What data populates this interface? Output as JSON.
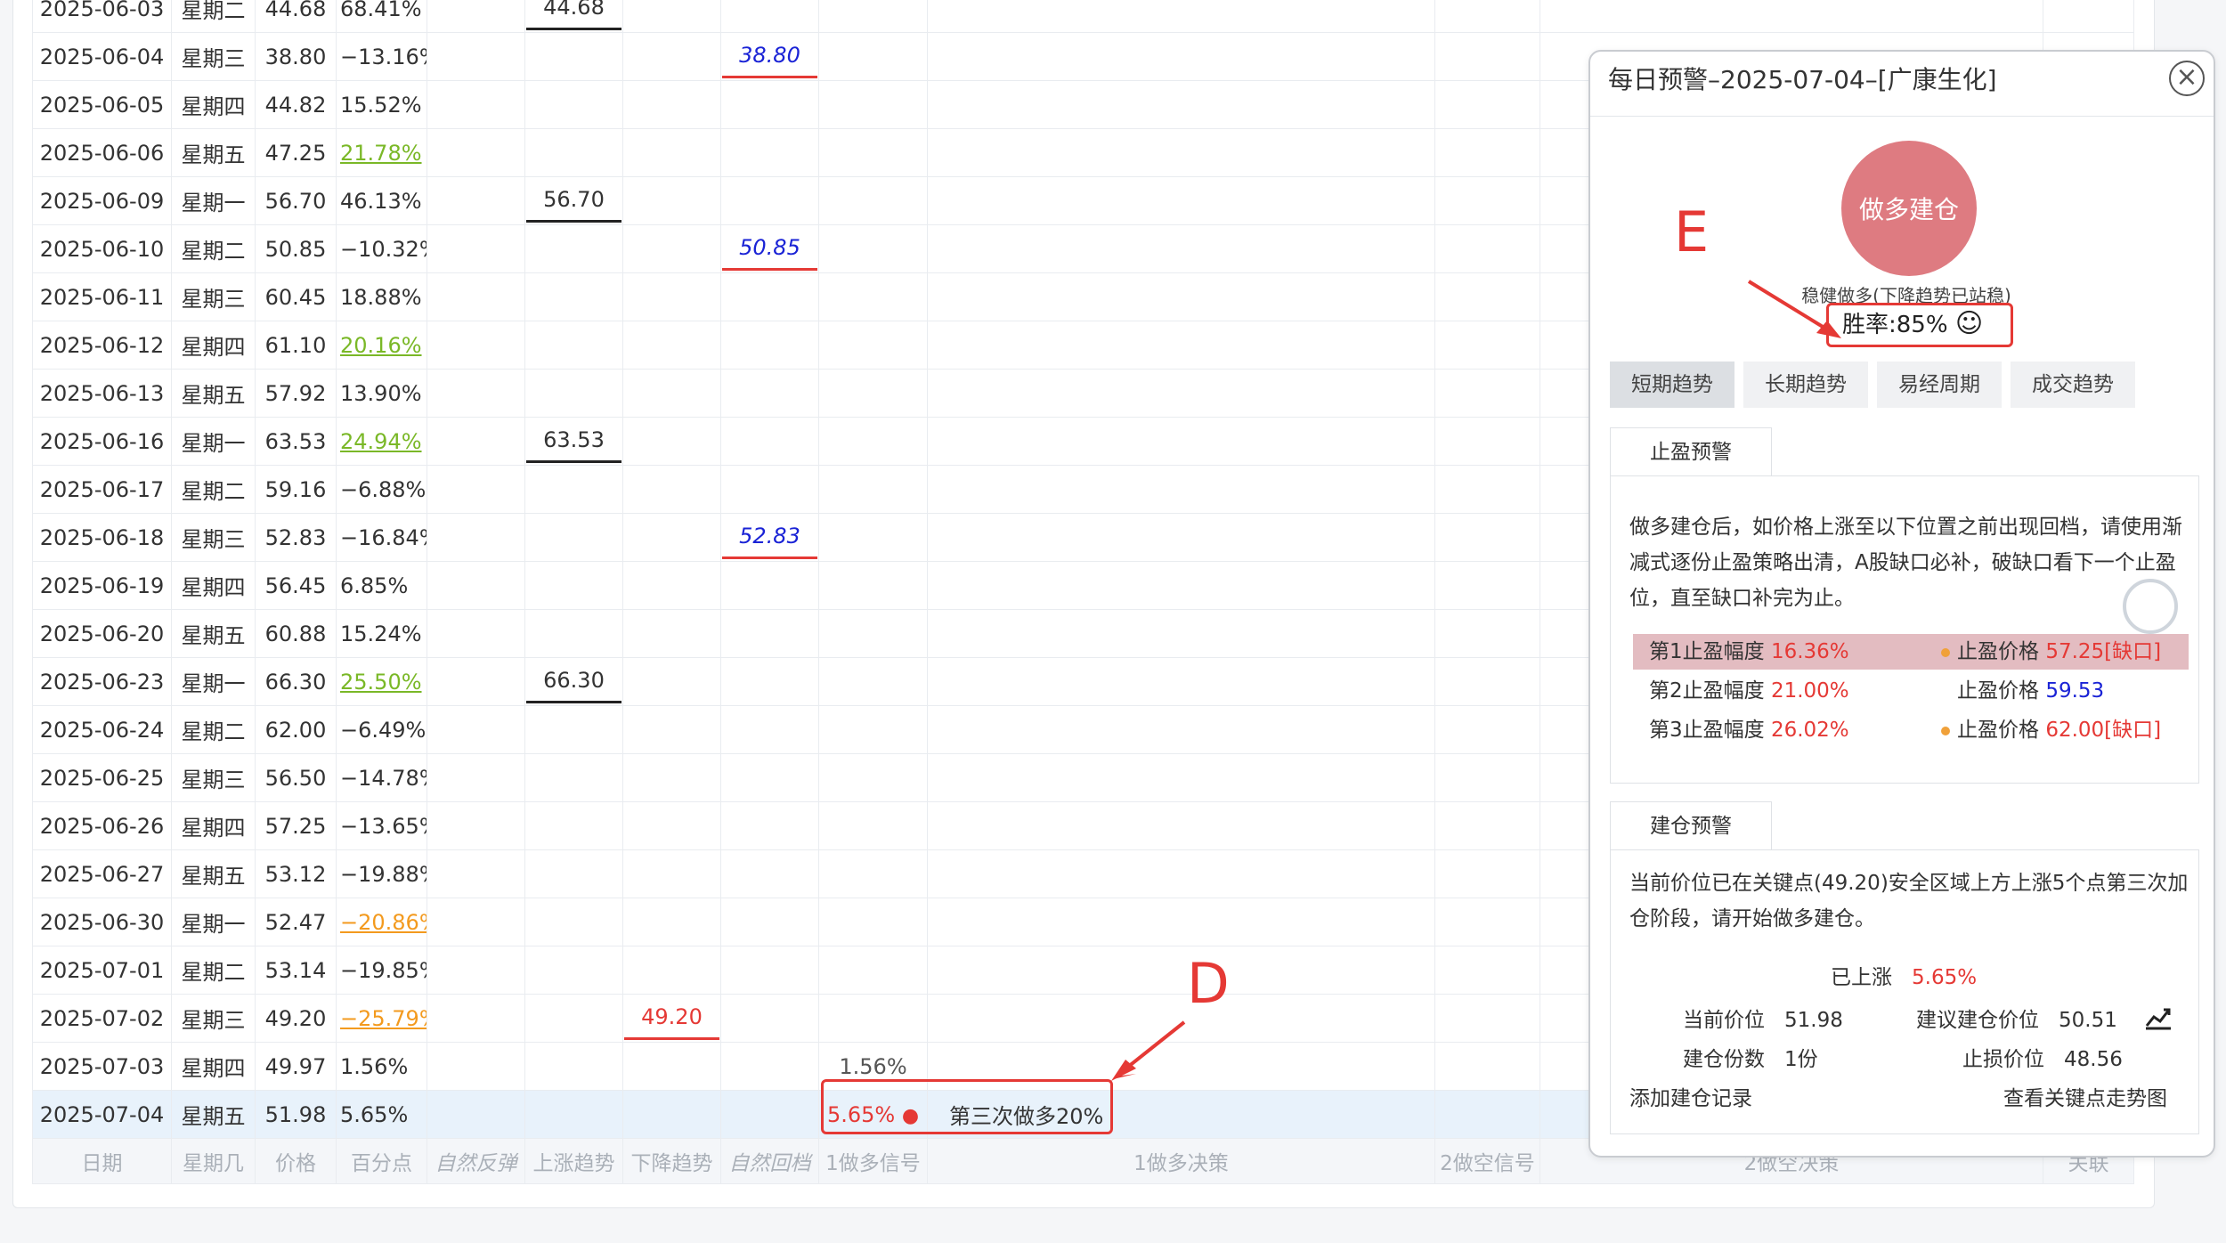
{
  "table": {
    "rows": [
      {
        "date": "2025-06-03",
        "week": "星期二",
        "price": "44.68",
        "pct": "68.41%",
        "pct_style": "",
        "up": "44.68",
        "down": "",
        "rebound": "",
        "pullback": "",
        "sig": ""
      },
      {
        "date": "2025-06-04",
        "week": "星期三",
        "price": "38.80",
        "pct": "−13.16%",
        "pct_style": "",
        "up": "",
        "down": "",
        "rebound": "",
        "pullback": "38.80",
        "sig": ""
      },
      {
        "date": "2025-06-05",
        "week": "星期四",
        "price": "44.82",
        "pct": "15.52%",
        "pct_style": "",
        "up": "",
        "down": "",
        "rebound": "",
        "pullback": "",
        "sig": ""
      },
      {
        "date": "2025-06-06",
        "week": "星期五",
        "price": "47.25",
        "pct": "21.78%",
        "pct_style": "green",
        "up": "",
        "down": "",
        "rebound": "",
        "pullback": "",
        "sig": ""
      },
      {
        "date": "2025-06-09",
        "week": "星期一",
        "price": "56.70",
        "pct": "46.13%",
        "pct_style": "",
        "up": "56.70",
        "down": "",
        "rebound": "",
        "pullback": "",
        "sig": ""
      },
      {
        "date": "2025-06-10",
        "week": "星期二",
        "price": "50.85",
        "pct": "−10.32%",
        "pct_style": "",
        "up": "",
        "down": "",
        "rebound": "",
        "pullback": "50.85",
        "sig": ""
      },
      {
        "date": "2025-06-11",
        "week": "星期三",
        "price": "60.45",
        "pct": "18.88%",
        "pct_style": "",
        "up": "",
        "down": "",
        "rebound": "",
        "pullback": "",
        "sig": ""
      },
      {
        "date": "2025-06-12",
        "week": "星期四",
        "price": "61.10",
        "pct": "20.16%",
        "pct_style": "green",
        "up": "",
        "down": "",
        "rebound": "",
        "pullback": "",
        "sig": ""
      },
      {
        "date": "2025-06-13",
        "week": "星期五",
        "price": "57.92",
        "pct": "13.90%",
        "pct_style": "",
        "up": "",
        "down": "",
        "rebound": "",
        "pullback": "",
        "sig": ""
      },
      {
        "date": "2025-06-16",
        "week": "星期一",
        "price": "63.53",
        "pct": "24.94%",
        "pct_style": "green",
        "up": "63.53",
        "down": "",
        "rebound": "",
        "pullback": "",
        "sig": ""
      },
      {
        "date": "2025-06-17",
        "week": "星期二",
        "price": "59.16",
        "pct": "−6.88%",
        "pct_style": "",
        "up": "",
        "down": "",
        "rebound": "",
        "pullback": "",
        "sig": ""
      },
      {
        "date": "2025-06-18",
        "week": "星期三",
        "price": "52.83",
        "pct": "−16.84%",
        "pct_style": "",
        "up": "",
        "down": "",
        "rebound": "",
        "pullback": "52.83",
        "sig": ""
      },
      {
        "date": "2025-06-19",
        "week": "星期四",
        "price": "56.45",
        "pct": "6.85%",
        "pct_style": "",
        "up": "",
        "down": "",
        "rebound": "",
        "pullback": "",
        "sig": ""
      },
      {
        "date": "2025-06-20",
        "week": "星期五",
        "price": "60.88",
        "pct": "15.24%",
        "pct_style": "",
        "up": "",
        "down": "",
        "rebound": "",
        "pullback": "",
        "sig": ""
      },
      {
        "date": "2025-06-23",
        "week": "星期一",
        "price": "66.30",
        "pct": "25.50%",
        "pct_style": "green",
        "up": "66.30",
        "down": "",
        "rebound": "",
        "pullback": "",
        "sig": ""
      },
      {
        "date": "2025-06-24",
        "week": "星期二",
        "price": "62.00",
        "pct": "−6.49%",
        "pct_style": "",
        "up": "",
        "down": "",
        "rebound": "",
        "pullback": "",
        "sig": ""
      },
      {
        "date": "2025-06-25",
        "week": "星期三",
        "price": "56.50",
        "pct": "−14.78%",
        "pct_style": "",
        "up": "",
        "down": "",
        "rebound": "",
        "pullback": "",
        "sig": ""
      },
      {
        "date": "2025-06-26",
        "week": "星期四",
        "price": "57.25",
        "pct": "−13.65%",
        "pct_style": "",
        "up": "",
        "down": "",
        "rebound": "",
        "pullback": "",
        "sig": ""
      },
      {
        "date": "2025-06-27",
        "week": "星期五",
        "price": "53.12",
        "pct": "−19.88%",
        "pct_style": "",
        "up": "",
        "down": "",
        "rebound": "",
        "pullback": "",
        "sig": ""
      },
      {
        "date": "2025-06-30",
        "week": "星期一",
        "price": "52.47",
        "pct": "−20.86%",
        "pct_style": "orange",
        "up": "",
        "down": "",
        "rebound": "",
        "pullback": "",
        "sig": ""
      },
      {
        "date": "2025-07-01",
        "week": "星期二",
        "price": "53.14",
        "pct": "−19.85%",
        "pct_style": "",
        "up": "",
        "down": "",
        "rebound": "",
        "pullback": "",
        "sig": ""
      },
      {
        "date": "2025-07-02",
        "week": "星期三",
        "price": "49.20",
        "pct": "−25.79%",
        "pct_style": "orange",
        "up": "",
        "down": "49.20",
        "rebound": "",
        "pullback": "",
        "sig": ""
      },
      {
        "date": "2025-07-03",
        "week": "星期四",
        "price": "49.97",
        "pct": "1.56%",
        "pct_style": "",
        "up": "",
        "down": "",
        "rebound": "",
        "pullback": "",
        "sig": "1.56%"
      },
      {
        "date": "2025-07-04",
        "week": "星期五",
        "price": "51.98",
        "pct": "5.65%",
        "pct_style": "",
        "up": "",
        "down": "",
        "rebound": "",
        "pullback": "",
        "sig": "5.65%",
        "decision": "第三次做多20%"
      }
    ],
    "footer": [
      "日期",
      "星期几",
      "价格",
      "百分点",
      "自然反弹",
      "上涨趋势",
      "下降趋势",
      "自然回档",
      "1做多信号",
      "1做多决策",
      "2做空信号",
      "2做空决策",
      "关联"
    ]
  },
  "annotations": {
    "d": "D",
    "e": "E"
  },
  "panel": {
    "title": "每日预警–2025-07-04–[广康生化]",
    "close": "×",
    "circle_label": "做多建仓",
    "subtitle": "稳健做多(下降趋势已站稳)",
    "win_rate": "胜率:85%",
    "smile": "☺",
    "tabs": [
      "短期趋势",
      "长期趋势",
      "易经周期",
      "成交趋势"
    ],
    "take_profit": {
      "tab": "止盈预警",
      "text": "做多建仓后，如价格上涨至以下位置之前出现回档，请使用渐减式逐份止盈策略出清，A股缺口必补，破缺口看下一个止盈位，直至缺口补完为止。",
      "rows": [
        {
          "label": "第1止盈幅度",
          "pct": "16.36%",
          "price_label": "止盈价格",
          "price": "57.25[缺口]",
          "gap": true
        },
        {
          "label": "第2止盈幅度",
          "pct": "21.00%",
          "price_label": "止盈价格",
          "price": "59.53",
          "gap": false
        },
        {
          "label": "第3止盈幅度",
          "pct": "26.02%",
          "price_label": "止盈价格",
          "price": "62.00[缺口]",
          "gap": true
        }
      ]
    },
    "build": {
      "tab": "建仓预警",
      "text": "当前价位已在关键点(49.20)安全区域上方上涨5个点第三次加仓阶段，请开始做多建仓。",
      "risen_label": "已上涨",
      "risen_value": "5.65%",
      "current_label": "当前价位",
      "current_value": "51.98",
      "suggest_label": "建议建仓价位",
      "suggest_value": "50.51",
      "shares_label": "建仓份数",
      "shares_value": "1份",
      "stop_label": "止损价位",
      "stop_value": "48.56",
      "add_record": "添加建仓记录",
      "view_chart": "查看关键点走势图"
    }
  },
  "colors": {
    "accent_red": "#e53935",
    "blue": "#1a23d6",
    "circle": "#de7b81",
    "green": "#7ab827",
    "orange": "#f39a1e"
  }
}
